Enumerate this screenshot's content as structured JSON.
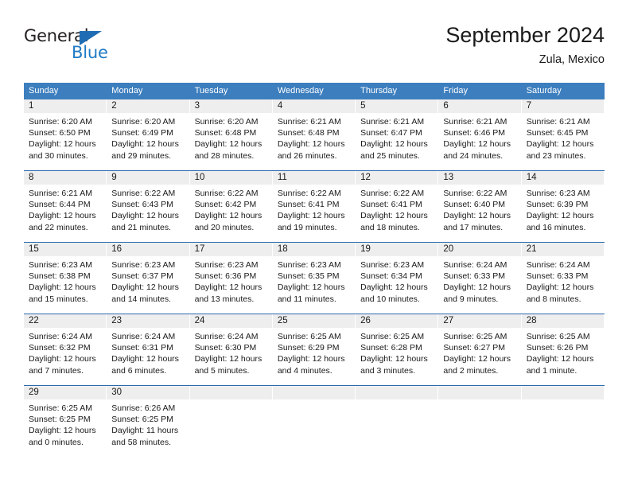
{
  "logo": {
    "word_top": "General",
    "word_bottom": "Blue",
    "triangle_icon": "blue-triangle-icon",
    "accent_color": "#1f7ac4"
  },
  "header": {
    "title": "September 2024",
    "subtitle": "Zula, Mexico"
  },
  "colors": {
    "header_blue": "#3c7ebe",
    "row_divider": "#2a6aad",
    "daynum_band": "#eeeeee",
    "text": "#1a1a1a"
  },
  "weekday_headers": [
    "Sunday",
    "Monday",
    "Tuesday",
    "Wednesday",
    "Thursday",
    "Friday",
    "Saturday"
  ],
  "weeks": [
    [
      {
        "day": "1",
        "sunrise": "Sunrise: 6:20 AM",
        "sunset": "Sunset: 6:50 PM",
        "daylight_line1": "Daylight: 12 hours",
        "daylight_line2": "and 30 minutes."
      },
      {
        "day": "2",
        "sunrise": "Sunrise: 6:20 AM",
        "sunset": "Sunset: 6:49 PM",
        "daylight_line1": "Daylight: 12 hours",
        "daylight_line2": "and 29 minutes."
      },
      {
        "day": "3",
        "sunrise": "Sunrise: 6:20 AM",
        "sunset": "Sunset: 6:48 PM",
        "daylight_line1": "Daylight: 12 hours",
        "daylight_line2": "and 28 minutes."
      },
      {
        "day": "4",
        "sunrise": "Sunrise: 6:21 AM",
        "sunset": "Sunset: 6:48 PM",
        "daylight_line1": "Daylight: 12 hours",
        "daylight_line2": "and 26 minutes."
      },
      {
        "day": "5",
        "sunrise": "Sunrise: 6:21 AM",
        "sunset": "Sunset: 6:47 PM",
        "daylight_line1": "Daylight: 12 hours",
        "daylight_line2": "and 25 minutes."
      },
      {
        "day": "6",
        "sunrise": "Sunrise: 6:21 AM",
        "sunset": "Sunset: 6:46 PM",
        "daylight_line1": "Daylight: 12 hours",
        "daylight_line2": "and 24 minutes."
      },
      {
        "day": "7",
        "sunrise": "Sunrise: 6:21 AM",
        "sunset": "Sunset: 6:45 PM",
        "daylight_line1": "Daylight: 12 hours",
        "daylight_line2": "and 23 minutes."
      }
    ],
    [
      {
        "day": "8",
        "sunrise": "Sunrise: 6:21 AM",
        "sunset": "Sunset: 6:44 PM",
        "daylight_line1": "Daylight: 12 hours",
        "daylight_line2": "and 22 minutes."
      },
      {
        "day": "9",
        "sunrise": "Sunrise: 6:22 AM",
        "sunset": "Sunset: 6:43 PM",
        "daylight_line1": "Daylight: 12 hours",
        "daylight_line2": "and 21 minutes."
      },
      {
        "day": "10",
        "sunrise": "Sunrise: 6:22 AM",
        "sunset": "Sunset: 6:42 PM",
        "daylight_line1": "Daylight: 12 hours",
        "daylight_line2": "and 20 minutes."
      },
      {
        "day": "11",
        "sunrise": "Sunrise: 6:22 AM",
        "sunset": "Sunset: 6:41 PM",
        "daylight_line1": "Daylight: 12 hours",
        "daylight_line2": "and 19 minutes."
      },
      {
        "day": "12",
        "sunrise": "Sunrise: 6:22 AM",
        "sunset": "Sunset: 6:41 PM",
        "daylight_line1": "Daylight: 12 hours",
        "daylight_line2": "and 18 minutes."
      },
      {
        "day": "13",
        "sunrise": "Sunrise: 6:22 AM",
        "sunset": "Sunset: 6:40 PM",
        "daylight_line1": "Daylight: 12 hours",
        "daylight_line2": "and 17 minutes."
      },
      {
        "day": "14",
        "sunrise": "Sunrise: 6:23 AM",
        "sunset": "Sunset: 6:39 PM",
        "daylight_line1": "Daylight: 12 hours",
        "daylight_line2": "and 16 minutes."
      }
    ],
    [
      {
        "day": "15",
        "sunrise": "Sunrise: 6:23 AM",
        "sunset": "Sunset: 6:38 PM",
        "daylight_line1": "Daylight: 12 hours",
        "daylight_line2": "and 15 minutes."
      },
      {
        "day": "16",
        "sunrise": "Sunrise: 6:23 AM",
        "sunset": "Sunset: 6:37 PM",
        "daylight_line1": "Daylight: 12 hours",
        "daylight_line2": "and 14 minutes."
      },
      {
        "day": "17",
        "sunrise": "Sunrise: 6:23 AM",
        "sunset": "Sunset: 6:36 PM",
        "daylight_line1": "Daylight: 12 hours",
        "daylight_line2": "and 13 minutes."
      },
      {
        "day": "18",
        "sunrise": "Sunrise: 6:23 AM",
        "sunset": "Sunset: 6:35 PM",
        "daylight_line1": "Daylight: 12 hours",
        "daylight_line2": "and 11 minutes."
      },
      {
        "day": "19",
        "sunrise": "Sunrise: 6:23 AM",
        "sunset": "Sunset: 6:34 PM",
        "daylight_line1": "Daylight: 12 hours",
        "daylight_line2": "and 10 minutes."
      },
      {
        "day": "20",
        "sunrise": "Sunrise: 6:24 AM",
        "sunset": "Sunset: 6:33 PM",
        "daylight_line1": "Daylight: 12 hours",
        "daylight_line2": "and 9 minutes."
      },
      {
        "day": "21",
        "sunrise": "Sunrise: 6:24 AM",
        "sunset": "Sunset: 6:33 PM",
        "daylight_line1": "Daylight: 12 hours",
        "daylight_line2": "and 8 minutes."
      }
    ],
    [
      {
        "day": "22",
        "sunrise": "Sunrise: 6:24 AM",
        "sunset": "Sunset: 6:32 PM",
        "daylight_line1": "Daylight: 12 hours",
        "daylight_line2": "and 7 minutes."
      },
      {
        "day": "23",
        "sunrise": "Sunrise: 6:24 AM",
        "sunset": "Sunset: 6:31 PM",
        "daylight_line1": "Daylight: 12 hours",
        "daylight_line2": "and 6 minutes."
      },
      {
        "day": "24",
        "sunrise": "Sunrise: 6:24 AM",
        "sunset": "Sunset: 6:30 PM",
        "daylight_line1": "Daylight: 12 hours",
        "daylight_line2": "and 5 minutes."
      },
      {
        "day": "25",
        "sunrise": "Sunrise: 6:25 AM",
        "sunset": "Sunset: 6:29 PM",
        "daylight_line1": "Daylight: 12 hours",
        "daylight_line2": "and 4 minutes."
      },
      {
        "day": "26",
        "sunrise": "Sunrise: 6:25 AM",
        "sunset": "Sunset: 6:28 PM",
        "daylight_line1": "Daylight: 12 hours",
        "daylight_line2": "and 3 minutes."
      },
      {
        "day": "27",
        "sunrise": "Sunrise: 6:25 AM",
        "sunset": "Sunset: 6:27 PM",
        "daylight_line1": "Daylight: 12 hours",
        "daylight_line2": "and 2 minutes."
      },
      {
        "day": "28",
        "sunrise": "Sunrise: 6:25 AM",
        "sunset": "Sunset: 6:26 PM",
        "daylight_line1": "Daylight: 12 hours",
        "daylight_line2": "and 1 minute."
      }
    ],
    [
      {
        "day": "29",
        "sunrise": "Sunrise: 6:25 AM",
        "sunset": "Sunset: 6:25 PM",
        "daylight_line1": "Daylight: 12 hours",
        "daylight_line2": "and 0 minutes."
      },
      {
        "day": "30",
        "sunrise": "Sunrise: 6:26 AM",
        "sunset": "Sunset: 6:25 PM",
        "daylight_line1": "Daylight: 11 hours",
        "daylight_line2": "and 58 minutes."
      },
      {
        "day": "",
        "sunrise": "",
        "sunset": "",
        "daylight_line1": "",
        "daylight_line2": ""
      },
      {
        "day": "",
        "sunrise": "",
        "sunset": "",
        "daylight_line1": "",
        "daylight_line2": ""
      },
      {
        "day": "",
        "sunrise": "",
        "sunset": "",
        "daylight_line1": "",
        "daylight_line2": ""
      },
      {
        "day": "",
        "sunrise": "",
        "sunset": "",
        "daylight_line1": "",
        "daylight_line2": ""
      },
      {
        "day": "",
        "sunrise": "",
        "sunset": "",
        "daylight_line1": "",
        "daylight_line2": ""
      }
    ]
  ]
}
